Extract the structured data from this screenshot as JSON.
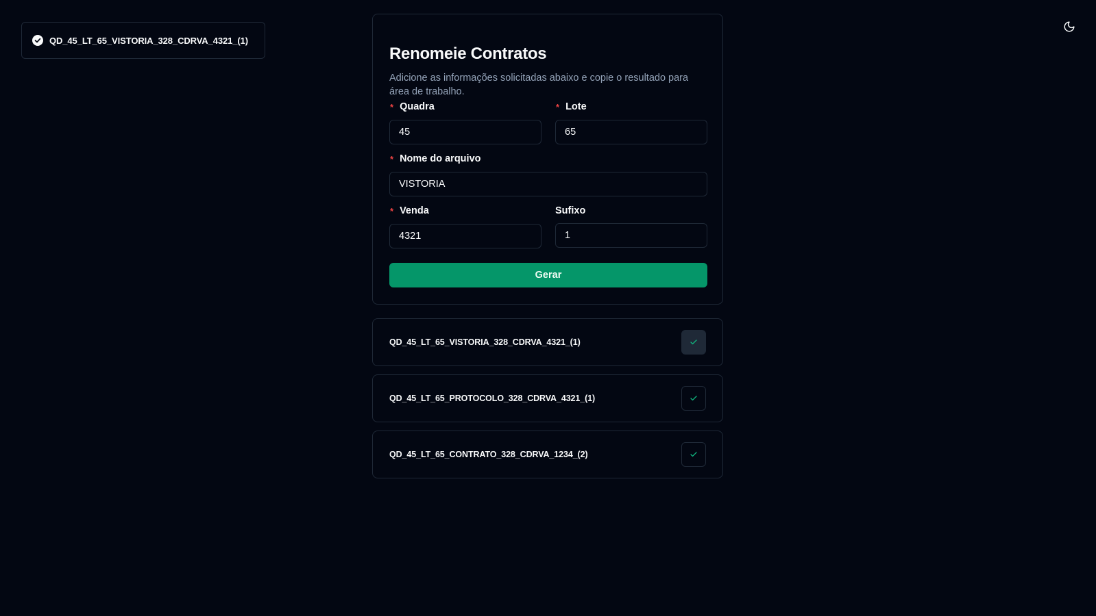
{
  "toast": {
    "icon": "check-circle-icon",
    "message": "QD_45_LT_65_VISTORIA_328_CDRVA_4321_(1)"
  },
  "theme_toggle": {
    "icon": "moon-icon"
  },
  "form": {
    "title": "Renomeie Contratos",
    "description": "Adicione as informações solicitadas abaixo e copie o resultado para área de trabalho.",
    "fields": {
      "quadra": {
        "label": "Quadra",
        "required": true,
        "value": "45"
      },
      "lote": {
        "label": "Lote",
        "required": true,
        "value": "65"
      },
      "nome_arquivo": {
        "label": "Nome do arquivo",
        "required": true,
        "value": "VISTORIA"
      },
      "venda": {
        "label": "Venda",
        "required": true,
        "value": "4321"
      },
      "sufixo": {
        "label": "Sufixo",
        "required": false,
        "value": "1"
      }
    },
    "required_marker": "*",
    "submit_label": "Gerar"
  },
  "results": [
    {
      "name": "QD_45_LT_65_VISTORIA_328_CDRVA_4321_(1)",
      "icon": "check-icon",
      "copied": true
    },
    {
      "name": "QD_45_LT_65_PROTOCOLO_328_CDRVA_4321_(1)",
      "icon": "check-icon",
      "copied": false
    },
    {
      "name": "QD_45_LT_65_CONTRATO_328_CDRVA_1234_(2)",
      "icon": "check-icon",
      "copied": false
    }
  ],
  "colors": {
    "background": "#030712",
    "border": "#1f2937",
    "accent": "#059669",
    "required": "#ef4444",
    "muted_text": "#94a3b8",
    "check": "#10b981"
  }
}
